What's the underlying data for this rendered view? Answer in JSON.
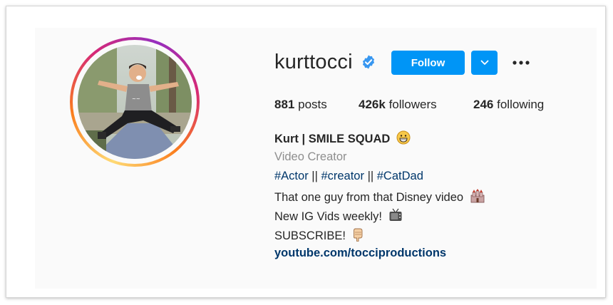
{
  "profile": {
    "username": "kurttocci",
    "verified": true,
    "follow_label": "Follow",
    "posts_count": "881",
    "posts_label": "posts",
    "followers_count": "426k",
    "followers_label": "followers",
    "following_count": "246",
    "following_label": "following"
  },
  "bio": {
    "name": "Kurt | SMILE SQUAD",
    "name_emoji": "grinning-face-icon",
    "category": "Video Creator",
    "hashtags": [
      "#Actor",
      "#creator",
      "#CatDad"
    ],
    "separator": "||",
    "line1": "That one guy from that Disney video",
    "line1_emoji": "castle-icon",
    "line2": "New IG Vids weekly!",
    "line2_emoji": "tv-icon",
    "line3": "SUBSCRIBE!",
    "line3_emoji": "pointing-down-icon",
    "link": "youtube.com/tocciproductions"
  },
  "colors": {
    "accent": "#0095f6",
    "link": "#00376b",
    "muted": "#8e8e8e",
    "text": "#262626"
  }
}
